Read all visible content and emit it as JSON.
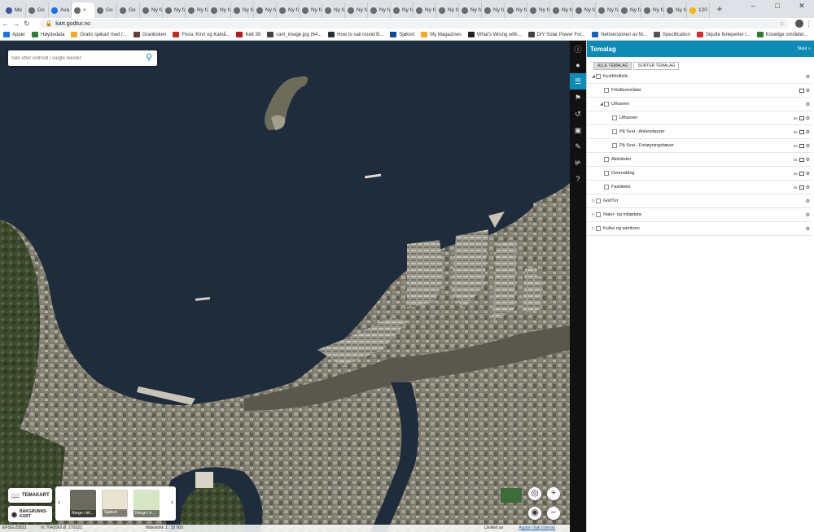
{
  "browser": {
    "tabs": [
      {
        "label": "Me",
        "favicon": "facebook-icon",
        "color": "#3b5998"
      },
      {
        "label": "Go",
        "favicon": "globe-icon",
        "color": "#6b6b6b"
      },
      {
        "label": "Ava",
        "favicon": "app-icon",
        "color": "#1a73e8"
      },
      {
        "label": "×",
        "favicon": "globe-icon",
        "color": "#6b6b6b",
        "active": true
      },
      {
        "label": "Go",
        "favicon": "globe-icon",
        "color": "#6b6b6b"
      },
      {
        "label": "Go",
        "favicon": "globe-icon",
        "color": "#6b6b6b"
      },
      {
        "label": "Ny fane",
        "favicon": "globe-icon",
        "color": "#6b6b6b"
      },
      {
        "label": "Ny fane",
        "favicon": "globe-icon",
        "color": "#6b6b6b"
      },
      {
        "label": "Ny fane",
        "favicon": "globe-icon",
        "color": "#6b6b6b"
      },
      {
        "label": "Ny fane",
        "favicon": "globe-icon",
        "color": "#6b6b6b"
      },
      {
        "label": "Ny fane",
        "favicon": "globe-icon",
        "color": "#6b6b6b"
      },
      {
        "label": "Ny fane",
        "favicon": "globe-icon",
        "color": "#6b6b6b"
      },
      {
        "label": "Ny fane",
        "favicon": "globe-icon",
        "color": "#6b6b6b"
      },
      {
        "label": "Ny fane",
        "favicon": "globe-icon",
        "color": "#6b6b6b"
      },
      {
        "label": "Ny fane",
        "favicon": "globe-icon",
        "color": "#6b6b6b"
      },
      {
        "label": "Ny fane",
        "favicon": "globe-icon",
        "color": "#6b6b6b"
      },
      {
        "label": "Ny fane",
        "favicon": "globe-icon",
        "color": "#6b6b6b"
      },
      {
        "label": "Ny fane",
        "favicon": "globe-icon",
        "color": "#6b6b6b"
      },
      {
        "label": "Ny fane",
        "favicon": "globe-icon",
        "color": "#6b6b6b"
      },
      {
        "label": "Ny fane",
        "favicon": "globe-icon",
        "color": "#6b6b6b"
      },
      {
        "label": "Ny fane",
        "favicon": "globe-icon",
        "color": "#6b6b6b"
      },
      {
        "label": "Ny fane",
        "favicon": "globe-icon",
        "color": "#6b6b6b"
      },
      {
        "label": "Ny fane",
        "favicon": "globe-icon",
        "color": "#6b6b6b"
      },
      {
        "label": "Ny fane",
        "favicon": "globe-icon",
        "color": "#6b6b6b"
      },
      {
        "label": "Ny fane",
        "favicon": "globe-icon",
        "color": "#6b6b6b"
      },
      {
        "label": "Ny fane",
        "favicon": "globe-icon",
        "color": "#6b6b6b"
      },
      {
        "label": "Ny fane",
        "favicon": "globe-icon",
        "color": "#6b6b6b"
      },
      {
        "label": "Ny fane",
        "favicon": "globe-icon",
        "color": "#6b6b6b"
      },
      {
        "label": "Ny fane",
        "favicon": "globe-icon",
        "color": "#6b6b6b"
      },
      {
        "label": "Ny fane",
        "favicon": "globe-icon",
        "color": "#6b6b6b"
      },
      {
        "label": "120",
        "favicon": "app-icon",
        "color": "#f4b400"
      }
    ],
    "new_tab": "+",
    "window_controls": [
      "–",
      "□",
      "✕"
    ],
    "url": "kart.godtur.no",
    "bookmarks": [
      {
        "label": "Apper",
        "color": "#1a73e8"
      },
      {
        "label": "Høydedata",
        "color": "#2e7d32"
      },
      {
        "label": "Gratis sjøkart med r...",
        "color": "#f9a825"
      },
      {
        "label": "Granboken",
        "color": "#5d4037"
      },
      {
        "label": "Flora: Kinn og Kalvå...",
        "color": "#c62828"
      },
      {
        "label": "Kelt 39",
        "color": "#b71c1c"
      },
      {
        "label": "cam_image.jpg (64...",
        "color": "#444444"
      },
      {
        "label": "How to sail round B...",
        "color": "#263238"
      },
      {
        "label": "Sjøkort",
        "color": "#0d47a1"
      },
      {
        "label": "My Magazines",
        "color": "#f9a825"
      },
      {
        "label": "What's Wrong with...",
        "color": "#212121"
      },
      {
        "label": "DIY Solar Power For...",
        "color": "#424242"
      },
      {
        "label": "Nettversjonen av M...",
        "color": "#1565c0"
      },
      {
        "label": "Specification",
        "color": "#555555"
      },
      {
        "label": "Skjulte ferieperler i...",
        "color": "#d32f2f"
      },
      {
        "label": "Koselige områder...",
        "color": "#2e7d32"
      }
    ],
    "more": "»"
  },
  "map": {
    "search_placeholder": "Søk etter innhold i valgte tekster",
    "temakart_label": "TEMAKART",
    "bakgrunnskart_label": "BAKGRUNNS-KART",
    "thumbnails": [
      "Norge i bil...",
      "Sjøkort",
      "Norge i b..."
    ],
    "zoom_in": "+",
    "zoom_out": "−",
    "status": {
      "projection": "EPSG:25833",
      "coords": "N: 7042069 Ø: 270522",
      "scale": "Målestokk 1 : 10 000",
      "attribution_prefix": "Utviklet av",
      "attribution_link": "Asplan Viak Internet"
    }
  },
  "panel": {
    "title": "Temalag",
    "hide_label": "Skjul »",
    "tabs": [
      "ALLE TEMALAG",
      "SORTER TEMALAG"
    ],
    "layers": [
      {
        "label": "Kystfriluftsliv",
        "level": 0,
        "expanded": true,
        "row_icons": [
          "gear-icon"
        ]
      },
      {
        "label": "Friluftsområder",
        "level": 1,
        "row_icons": [
          "table-icon",
          "gear-icon"
        ]
      },
      {
        "label": "Uthavner",
        "level": 1,
        "expanded": true,
        "row_icons": [
          "gear-icon"
        ]
      },
      {
        "label": "Uthavner",
        "level": 2,
        "row_icons": [
          "text-icon",
          "table-icon",
          "gear-icon"
        ]
      },
      {
        "label": "På Svai - Ankerplasser",
        "level": 2,
        "row_icons": [
          "text-icon",
          "table-icon",
          "gear-icon"
        ]
      },
      {
        "label": "På Svai - Fortøyningsbøyer",
        "level": 2,
        "row_icons": [
          "text-icon",
          "table-icon",
          "gear-icon"
        ]
      },
      {
        "label": "Aktiviteter",
        "level": 1,
        "row_icons": [
          "text-icon",
          "table-icon",
          "gear-icon"
        ]
      },
      {
        "label": "Overnatting",
        "level": 1,
        "row_icons": [
          "text-icon",
          "table-icon",
          "gear-icon"
        ]
      },
      {
        "label": "Fasiliteter",
        "level": 1,
        "row_icons": [
          "text-icon",
          "table-icon",
          "gear-icon"
        ]
      },
      {
        "label": "GodTur",
        "level": 0,
        "expanded": false,
        "row_icons": [
          "gear-icon"
        ]
      },
      {
        "label": "Natur- og miljødata",
        "level": 0,
        "expanded": false,
        "row_icons": [
          "gear-icon"
        ]
      },
      {
        "label": "Kultur og samfunn",
        "level": 0,
        "expanded": false,
        "row_icons": [
          "gear-icon"
        ]
      }
    ],
    "text_icon_label": "txt",
    "sidebar_icons": [
      "info-icon",
      "user-icon",
      "layers-icon",
      "tag-icon",
      "share-icon",
      "toolbox-icon",
      "pencil-icon",
      "measure-icon",
      "help-icon"
    ],
    "accent": "#0e8bb5"
  }
}
